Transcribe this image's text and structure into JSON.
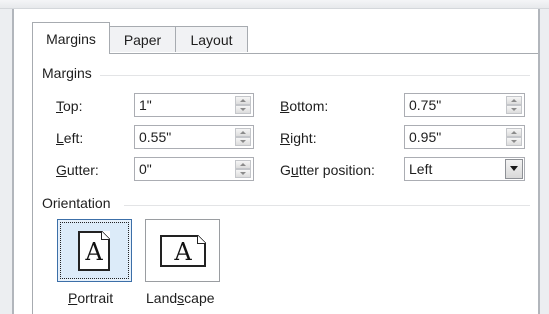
{
  "tabs": [
    {
      "label": "Margins",
      "active": true
    },
    {
      "label": "Paper",
      "active": false
    },
    {
      "label": "Layout",
      "active": false
    }
  ],
  "margins": {
    "title": "Margins",
    "top": {
      "label_hotkey": "T",
      "label_rest": "op:",
      "value": "1\""
    },
    "bottom": {
      "label_hotkey": "B",
      "label_rest": "ottom:",
      "value": "0.75\""
    },
    "left": {
      "label_hotkey": "L",
      "label_rest": "eft:",
      "value": "0.55\""
    },
    "right": {
      "label_hotkey": "R",
      "label_rest": "ight:",
      "value": "0.95\""
    },
    "gutter": {
      "label_hotkey": "G",
      "label_rest": "utter:",
      "value": "0\""
    },
    "gutter_position": {
      "label_pre": "G",
      "label_hotkey": "u",
      "label_rest": "tter position:",
      "value": "Left"
    }
  },
  "orientation": {
    "title": "Orientation",
    "portrait": {
      "glyph": "A",
      "label_hotkey": "P",
      "label_rest": "ortrait",
      "selected": true
    },
    "landscape": {
      "glyph": "A",
      "label_pre": "Land",
      "label_hotkey": "s",
      "label_rest": "cape",
      "selected": false
    }
  },
  "colors": {
    "tab_border": "#a7abb0",
    "selected_border": "#3c6fa8",
    "selected_fill": "#dcebf9"
  }
}
